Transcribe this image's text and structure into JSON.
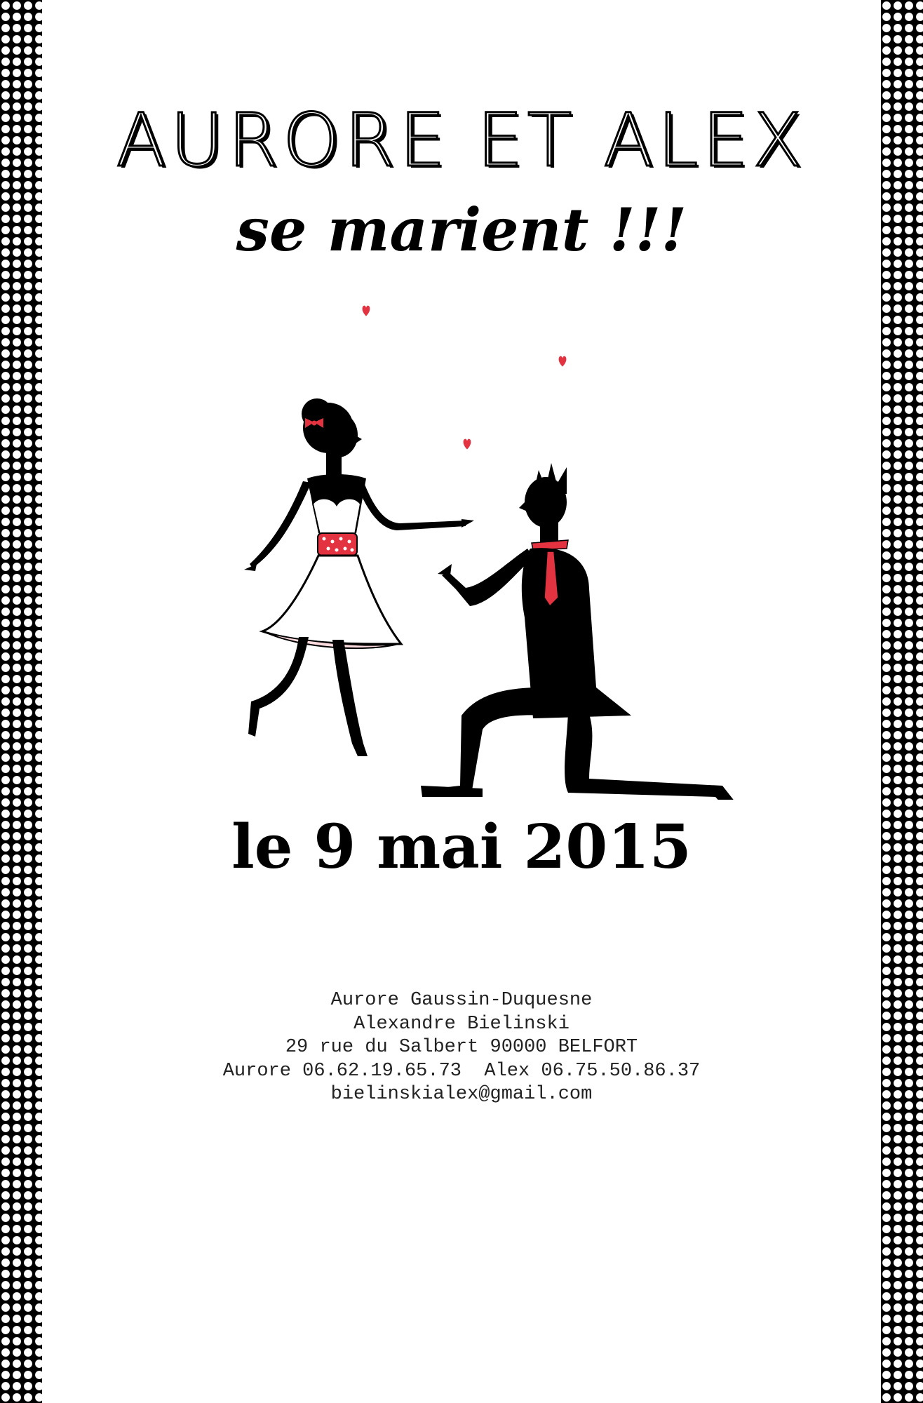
{
  "colors": {
    "background": "#ffffff",
    "ink": "#000000",
    "accent": "#e33240",
    "dots": "#ffffff"
  },
  "icons": {
    "hearts": "heart-icon",
    "illustration": "couple-proposal-silhouette"
  },
  "invitation": {
    "title": "AURORE ET ALEX",
    "subtitle": "se marient !!!",
    "date": "le 9 mai 2015"
  },
  "contact": {
    "lines": [
      "Aurore Gaussin-Duquesne",
      "Alexandre Bielinski",
      "29 rue du Salbert 90000 BELFORT",
      "Aurore 06.62.19.65.73  Alex 06.75.50.86.37",
      "bielinskialex@gmail.com"
    ]
  }
}
